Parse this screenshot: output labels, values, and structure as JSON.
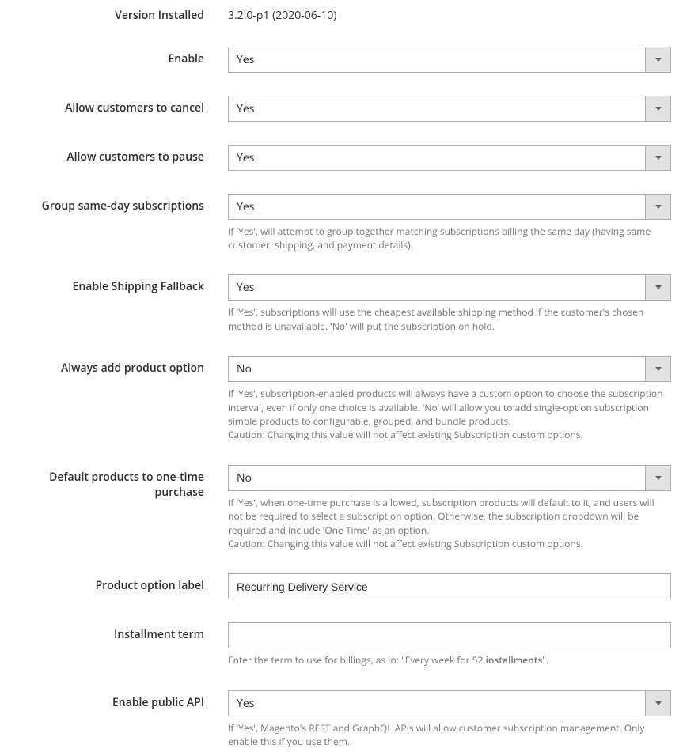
{
  "fields": {
    "version_installed": {
      "label": "Version Installed",
      "value": "3.2.0-p1 (2020-06-10)"
    },
    "enable": {
      "label": "Enable",
      "value": "Yes"
    },
    "allow_cancel": {
      "label": "Allow customers to cancel",
      "value": "Yes"
    },
    "allow_pause": {
      "label": "Allow customers to pause",
      "value": "Yes"
    },
    "group_same_day": {
      "label": "Group same-day subscriptions",
      "value": "Yes",
      "note": "If 'Yes', will attempt to group together matching subscriptions billing the same day (having same customer, shipping, and payment details)."
    },
    "shipping_fallback": {
      "label": "Enable Shipping Fallback",
      "value": "Yes",
      "note": "If 'Yes', subscriptions will use the cheapest available shipping method if the customer's chosen method is unavailable. 'No' will put the subscription on hold."
    },
    "always_add_option": {
      "label": "Always add product option",
      "value": "No",
      "note": "If 'Yes', subscription-enabled products will always have a custom option to choose the subscription interval, even if only one choice is available. 'No' will allow you to add single-option subscription simple products to configurable, grouped, and bundle products.",
      "caution": "Caution: Changing this value will not affect existing Subscription custom options."
    },
    "default_one_time": {
      "label": "Default products to one-time purchase",
      "value": "No",
      "note": "If 'Yes', when one-time purchase is allowed, subscription products will default to it, and users will not be required to select a subscription option. Otherwise, the subscription dropdown will be required and include 'One Time' as an option.",
      "caution": "Caution: Changing this value will not affect existing Subscription custom options."
    },
    "product_option_label": {
      "label": "Product option label",
      "value": "Recurring Delivery Service"
    },
    "installment_term": {
      "label": "Installment term",
      "value": "",
      "note_prefix": "Enter the term to use for billings, as in: \"Every week for 52 ",
      "note_strong": "installments",
      "note_suffix": "\"."
    },
    "enable_public_api": {
      "label": "Enable public API",
      "value": "Yes",
      "note": "If 'Yes', Magento's REST and GraphQL APIs will allow customer subscription management. Only enable this if you use them."
    }
  }
}
